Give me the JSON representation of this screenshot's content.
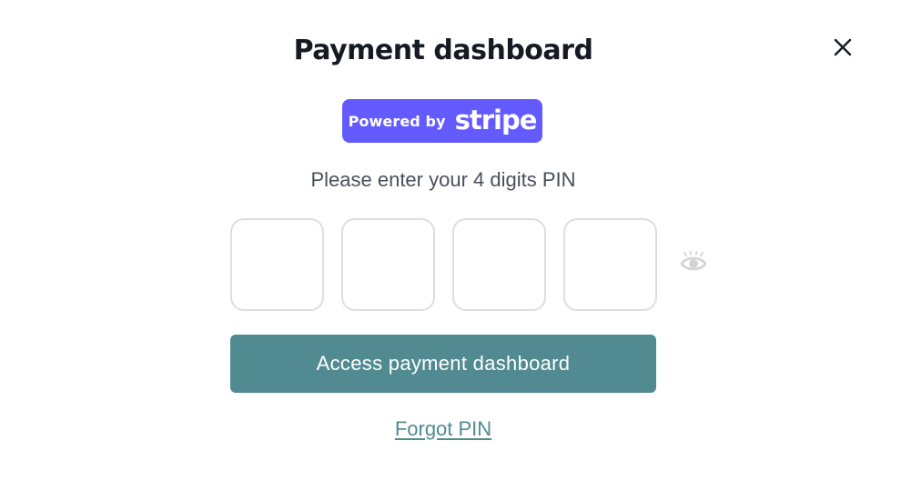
{
  "modal": {
    "title": "Payment dashboard",
    "close_icon": "close-icon",
    "badge": {
      "prefix": "Powered by",
      "brand": "stripe",
      "color": "#635bff"
    },
    "prompt": "Please enter your 4 digits PIN",
    "pin": {
      "digit_count": 4,
      "values": [
        "",
        "",
        "",
        ""
      ],
      "toggle_icon": "eye-icon"
    },
    "submit_label": "Access payment dashboard",
    "forgot_label": "Forgot PIN",
    "colors": {
      "accent": "#518b91",
      "title": "#161a22",
      "prompt": "#4a4f5c",
      "pin_border": "#dedede"
    }
  }
}
